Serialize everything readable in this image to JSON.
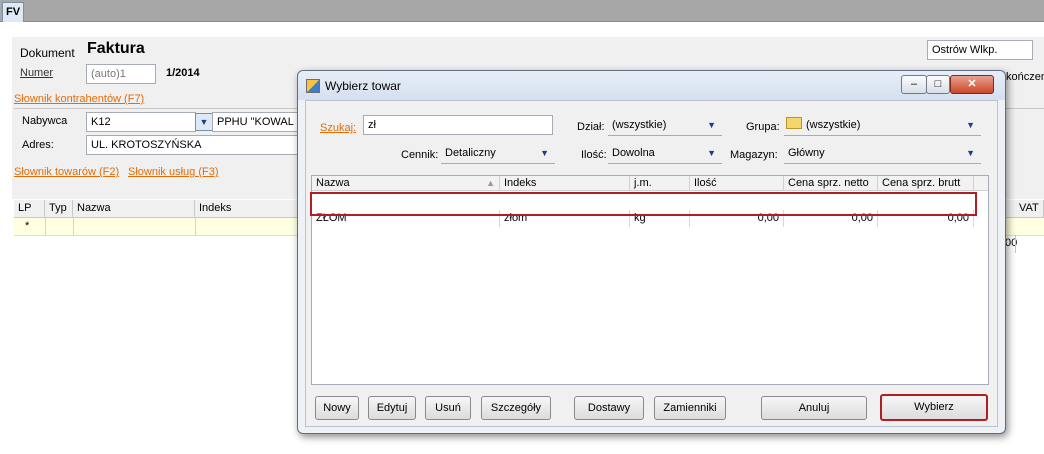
{
  "tab": {
    "label": "FV"
  },
  "document": {
    "label": "Dokument",
    "title": "Faktura",
    "number_link": "Numer",
    "number_value": "(auto)1",
    "number_suffix": "1/2014",
    "city": "Ostrów Wlkp.",
    "right_partial": "kończen"
  },
  "contractor": {
    "dictionary_link": "Słownik kontrahentów (F7)",
    "buyer_label": "Nabywca",
    "buyer_code": "K12",
    "buyer_name": "PPHU \"KOWAL",
    "address_label": "Adres:",
    "address_value": "UL. KROTOSZYŃSKA"
  },
  "links": {
    "goods": "Słownik towarów (F2)",
    "services": "Słownik usług (F3)"
  },
  "items_table": {
    "columns": [
      "LP",
      "Typ",
      "Nazwa",
      "Indeks",
      "VAT"
    ],
    "new_row_marker": "*",
    "partial_value": "00"
  },
  "dialog": {
    "title": "Wybierz towar",
    "search_label": "Szukaj:",
    "search_value": "zł",
    "dept_label": "Dział:",
    "dept_value": "(wszystkie)",
    "group_label": "Grupa:",
    "group_value": "(wszystkie)",
    "pricelist_label": "Cennik:",
    "pricelist_value": "Detaliczny",
    "qty_label": "Ilość:",
    "qty_value": "Dowolna",
    "warehouse_label": "Magazyn:",
    "warehouse_value": "Główny",
    "columns": [
      "Nazwa",
      "Indeks",
      "j.m.",
      "Ilość",
      "Cena sprz. netto",
      "Cena sprz. brutt"
    ],
    "rows": [
      {
        "name": "ZŁOM",
        "index": "złom",
        "unit": "kg",
        "qty": "0,00",
        "net": "0,00",
        "gross": "0,00"
      }
    ],
    "buttons": {
      "new": "Nowy",
      "edit": "Edytuj",
      "delete": "Usuń",
      "details": "Szczegóły",
      "deliveries": "Dostawy",
      "substitutes": "Zamienniki",
      "cancel": "Anuluj",
      "select": "Wybierz"
    },
    "highlight_color": "#b01e23"
  }
}
